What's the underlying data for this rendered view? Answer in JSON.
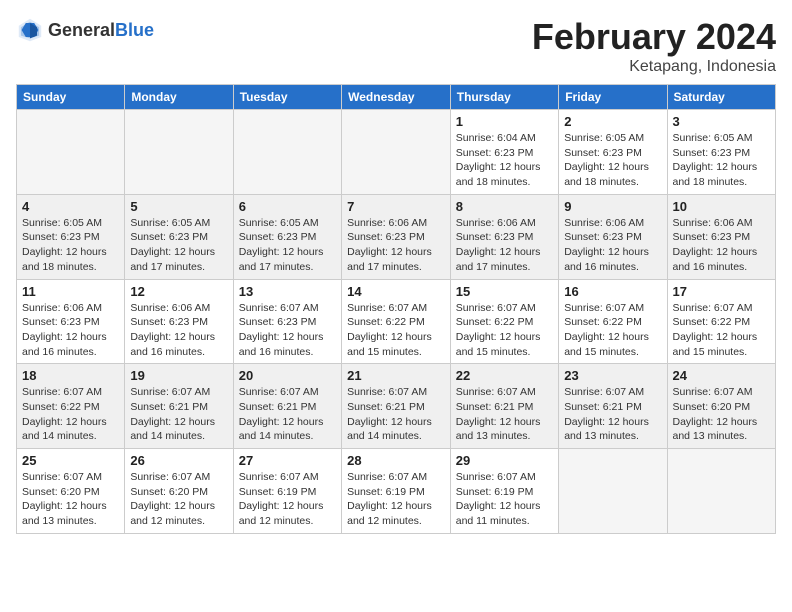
{
  "header": {
    "logo_general": "General",
    "logo_blue": "Blue",
    "month": "February 2024",
    "location": "Ketapang, Indonesia"
  },
  "weekdays": [
    "Sunday",
    "Monday",
    "Tuesday",
    "Wednesday",
    "Thursday",
    "Friday",
    "Saturday"
  ],
  "weeks": [
    [
      {
        "day": "",
        "info": ""
      },
      {
        "day": "",
        "info": ""
      },
      {
        "day": "",
        "info": ""
      },
      {
        "day": "",
        "info": ""
      },
      {
        "day": "1",
        "info": "Sunrise: 6:04 AM\nSunset: 6:23 PM\nDaylight: 12 hours\nand 18 minutes."
      },
      {
        "day": "2",
        "info": "Sunrise: 6:05 AM\nSunset: 6:23 PM\nDaylight: 12 hours\nand 18 minutes."
      },
      {
        "day": "3",
        "info": "Sunrise: 6:05 AM\nSunset: 6:23 PM\nDaylight: 12 hours\nand 18 minutes."
      }
    ],
    [
      {
        "day": "4",
        "info": "Sunrise: 6:05 AM\nSunset: 6:23 PM\nDaylight: 12 hours\nand 18 minutes."
      },
      {
        "day": "5",
        "info": "Sunrise: 6:05 AM\nSunset: 6:23 PM\nDaylight: 12 hours\nand 17 minutes."
      },
      {
        "day": "6",
        "info": "Sunrise: 6:05 AM\nSunset: 6:23 PM\nDaylight: 12 hours\nand 17 minutes."
      },
      {
        "day": "7",
        "info": "Sunrise: 6:06 AM\nSunset: 6:23 PM\nDaylight: 12 hours\nand 17 minutes."
      },
      {
        "day": "8",
        "info": "Sunrise: 6:06 AM\nSunset: 6:23 PM\nDaylight: 12 hours\nand 17 minutes."
      },
      {
        "day": "9",
        "info": "Sunrise: 6:06 AM\nSunset: 6:23 PM\nDaylight: 12 hours\nand 16 minutes."
      },
      {
        "day": "10",
        "info": "Sunrise: 6:06 AM\nSunset: 6:23 PM\nDaylight: 12 hours\nand 16 minutes."
      }
    ],
    [
      {
        "day": "11",
        "info": "Sunrise: 6:06 AM\nSunset: 6:23 PM\nDaylight: 12 hours\nand 16 minutes."
      },
      {
        "day": "12",
        "info": "Sunrise: 6:06 AM\nSunset: 6:23 PM\nDaylight: 12 hours\nand 16 minutes."
      },
      {
        "day": "13",
        "info": "Sunrise: 6:07 AM\nSunset: 6:23 PM\nDaylight: 12 hours\nand 16 minutes."
      },
      {
        "day": "14",
        "info": "Sunrise: 6:07 AM\nSunset: 6:22 PM\nDaylight: 12 hours\nand 15 minutes."
      },
      {
        "day": "15",
        "info": "Sunrise: 6:07 AM\nSunset: 6:22 PM\nDaylight: 12 hours\nand 15 minutes."
      },
      {
        "day": "16",
        "info": "Sunrise: 6:07 AM\nSunset: 6:22 PM\nDaylight: 12 hours\nand 15 minutes."
      },
      {
        "day": "17",
        "info": "Sunrise: 6:07 AM\nSunset: 6:22 PM\nDaylight: 12 hours\nand 15 minutes."
      }
    ],
    [
      {
        "day": "18",
        "info": "Sunrise: 6:07 AM\nSunset: 6:22 PM\nDaylight: 12 hours\nand 14 minutes."
      },
      {
        "day": "19",
        "info": "Sunrise: 6:07 AM\nSunset: 6:21 PM\nDaylight: 12 hours\nand 14 minutes."
      },
      {
        "day": "20",
        "info": "Sunrise: 6:07 AM\nSunset: 6:21 PM\nDaylight: 12 hours\nand 14 minutes."
      },
      {
        "day": "21",
        "info": "Sunrise: 6:07 AM\nSunset: 6:21 PM\nDaylight: 12 hours\nand 14 minutes."
      },
      {
        "day": "22",
        "info": "Sunrise: 6:07 AM\nSunset: 6:21 PM\nDaylight: 12 hours\nand 13 minutes."
      },
      {
        "day": "23",
        "info": "Sunrise: 6:07 AM\nSunset: 6:21 PM\nDaylight: 12 hours\nand 13 minutes."
      },
      {
        "day": "24",
        "info": "Sunrise: 6:07 AM\nSunset: 6:20 PM\nDaylight: 12 hours\nand 13 minutes."
      }
    ],
    [
      {
        "day": "25",
        "info": "Sunrise: 6:07 AM\nSunset: 6:20 PM\nDaylight: 12 hours\nand 13 minutes."
      },
      {
        "day": "26",
        "info": "Sunrise: 6:07 AM\nSunset: 6:20 PM\nDaylight: 12 hours\nand 12 minutes."
      },
      {
        "day": "27",
        "info": "Sunrise: 6:07 AM\nSunset: 6:19 PM\nDaylight: 12 hours\nand 12 minutes."
      },
      {
        "day": "28",
        "info": "Sunrise: 6:07 AM\nSunset: 6:19 PM\nDaylight: 12 hours\nand 12 minutes."
      },
      {
        "day": "29",
        "info": "Sunrise: 6:07 AM\nSunset: 6:19 PM\nDaylight: 12 hours\nand 11 minutes."
      },
      {
        "day": "",
        "info": ""
      },
      {
        "day": "",
        "info": ""
      }
    ]
  ]
}
